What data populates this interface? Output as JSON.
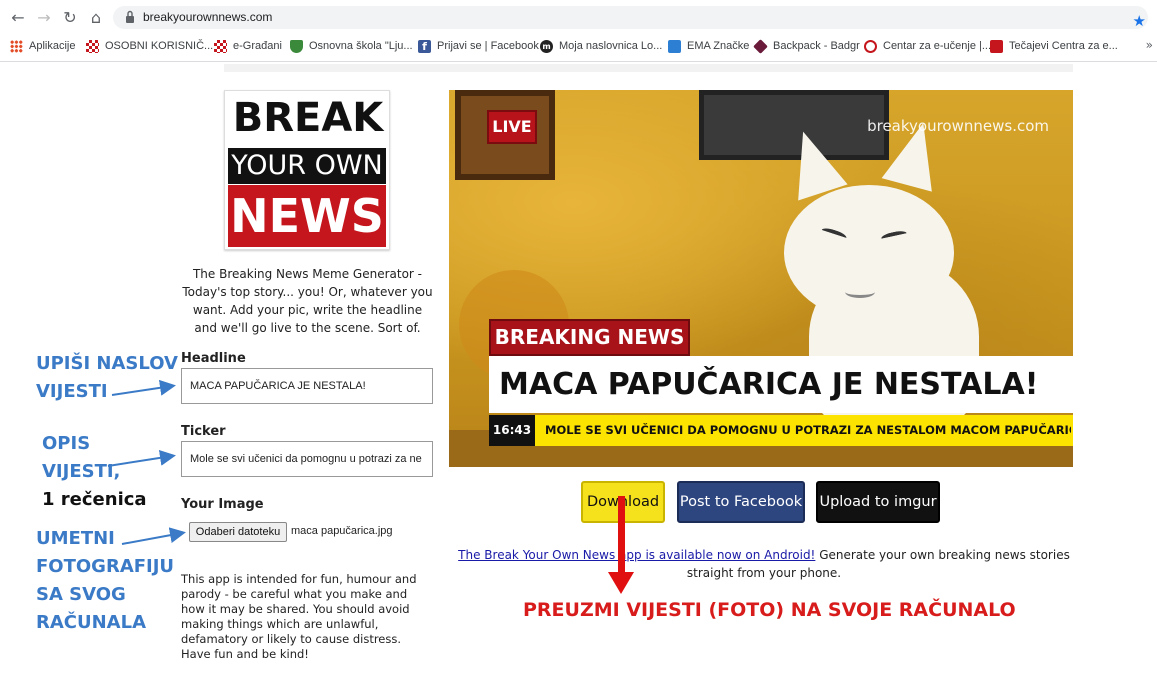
{
  "browser": {
    "url": "breakyourownnews.com",
    "bookmarks": [
      {
        "label": "Aplikacije",
        "icon": "apps-grid-icon",
        "color": "#e34c26"
      },
      {
        "label": "OSOBNI KORISNIČ...",
        "icon": "checkerboard-icon",
        "color": "#c4161c"
      },
      {
        "label": "e-Građani",
        "icon": "checkerboard-icon",
        "color": "#c4161c"
      },
      {
        "label": "Osnovna škola \"Lju...",
        "icon": "shield-icon",
        "color": "#3b8a3b"
      },
      {
        "label": "Prijavi se | Facebook",
        "icon": "facebook-icon",
        "color": "#3b5998"
      },
      {
        "label": "Moja naslovnica Lo...",
        "icon": "moodle-icon",
        "color": "#222222"
      },
      {
        "label": "EMA Značke",
        "icon": "ema-icon",
        "color": "#2d7fd3"
      },
      {
        "label": "Backpack - Badgr",
        "icon": "badgr-icon",
        "color": "#6a1b3a"
      },
      {
        "label": "Centar za e-učenje |...",
        "icon": "at-icon",
        "color": "#c4161c"
      },
      {
        "label": "Tečajevi Centra za e...",
        "icon": "course-icon",
        "color": "#c4161c"
      }
    ],
    "more": "»"
  },
  "logo": {
    "line1": "BREAK",
    "line2": "YOUR OWN",
    "line3": "NEWS"
  },
  "intro": "The Breaking News Meme Generator - Today's top story... you! Or, whatever you want. Add your pic, write the headline and we'll go live to the scene. Sort of.",
  "form": {
    "headline_label": "Headline",
    "headline_value": "MACA PAPUČARICA JE NESTALA!",
    "ticker_label": "Ticker",
    "ticker_value": "Mole se svi učenici da pomognu u potrazi za ne",
    "image_label": "Your Image",
    "file_button": "Odaberi datoteku",
    "file_name": "maca papučarica.jpg"
  },
  "disclaimer": "This app is intended for fun, humour and parody - be careful what you make and how it may be shared. You should avoid making things which are unlawful, defamatory or likely to cause distress. Have fun and be kind!",
  "annotations": {
    "a1_line1": "UPIŠI NASLOV",
    "a1_line2": "VIJESTI",
    "a2_line1": "OPIS",
    "a2_line2": "VIJESTI,",
    "a2_line3": "1 rečenica",
    "a3_line1": "UMETNI",
    "a3_line2": "FOTOGRAFIJU",
    "a3_line3": "SA SVOG",
    "a3_line4": "RAČUNALA",
    "download_note": "PREUZMI VIJESTI (FOTO) NA SVOJE RAČUNALO"
  },
  "meme": {
    "live": "LIVE",
    "watermark": "breakyourownnews.com",
    "breaking_label": "BREAKING NEWS",
    "headline": "MACA PAPUČARICA JE NESTALA!",
    "time": "16:43",
    "ticker": "MOLE SE SVI UČENICI DA POMOGNU U POTRAZI ZA NESTALOM MACOM PAPUČARICOM"
  },
  "buttons": {
    "download": "Download",
    "facebook": "Post to Facebook",
    "imgur": "Upload to imgur"
  },
  "android": {
    "link": "The Break Your Own News app is available now on Android!",
    "text": " Generate your own breaking news stories straight from your phone."
  },
  "colors": {
    "annotation_blue": "#3a7ac6",
    "annotation_red": "#d81b1b",
    "brand_red": "#c4161c",
    "ticker_yellow": "#fde300"
  }
}
